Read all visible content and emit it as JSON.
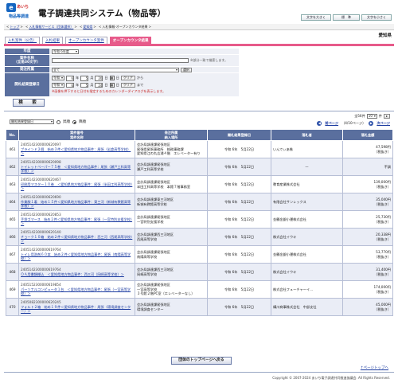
{
  "logo": {
    "mark": "e",
    "top_text": "あいち",
    "bottom_text": "物品等調達",
    "mark_icon": "aichi-logo-icon"
  },
  "site_title": "電子調達共同システム（物品等）",
  "header_buttons": [
    "文字を大きく",
    "標　準",
    "文字を小さく"
  ],
  "breadcrumb": [
    "トップ",
    "入札情報サービス（団体選択）",
    "愛知県",
    "入札情報-オープンカウンタ結果"
  ],
  "prefecture": "愛知県",
  "tabs": [
    "入札案件（公告）",
    "入札結果",
    "オープンカウンタ案件",
    "オープンカウンタ結果"
  ],
  "active_tab": 3,
  "search": {
    "fiscal_year_label": "年度",
    "fiscal_year_value": "令和 6年度",
    "case_name_label": "案件名称\n（全角30文字）",
    "case_name_value": "",
    "case_name_note": "※部分一致で検索します。",
    "office_label": "発注所属",
    "office_value": "全て",
    "office_button": "選択",
    "date_label": "開札結果登録日",
    "from": {
      "era": "令和",
      "year": "6",
      "year_unit": "年",
      "month": "5",
      "month_unit": "月",
      "day": "20",
      "day_unit": "日",
      "suffix": "日",
      "clear": "クリア",
      "tail": "から"
    },
    "to": {
      "era": "令和",
      "year": "6",
      "year_unit": "年",
      "month": "5",
      "month_unit": "月",
      "day": "24",
      "day_unit": "日",
      "suffix": "日",
      "clear": "クリア",
      "tail": "まで"
    },
    "calendar_icon": "calendar-icon",
    "date_note": "※画像を押下すると日付を指定するためのカレンダーダイアログを表示します。",
    "search_button": "検　索"
  },
  "list_controls": {
    "sort_select": "開札結果登録日",
    "sort_asc": "昇順",
    "sort_desc": "降順",
    "sort_selected": "desc",
    "total": "全56件",
    "per_page": "10",
    "per_page_unit": "件",
    "prev": "前ページ",
    "page_status": "（4/10ページ）",
    "next": "次ページ"
  },
  "table": {
    "headers": {
      "no": "No.",
      "case": "案件番号\n案件名称",
      "office": "発注所属\n納入場所",
      "date": "開札結果登録日",
      "winner": "落札者",
      "amount": "落札金額"
    },
    "rows": [
      {
        "no": "461",
        "case_no": "2405142300000620097",
        "case_name": "ブラインド２個　始め３件＜愛知県地方物品事件：尾張（岩倉高等学校）＞",
        "office": "会計局調達課尾張地区",
        "place": "尾張県尾張事務所　総務事務課\n愛知県江の丸吉浦４階　エレベーター有り",
        "date": "令和 6年　5月22日",
        "winner": "いんでぃあ株",
        "amount": "47,598円",
        "tax": "（税抜き）"
      },
      {
        "no": "462",
        "case_no": "2405142300000620098",
        "case_name": "トイレットペーパー７５巻　＜愛知県地方物品事件：尾張（瀬戸工科高等学校）＞",
        "office": "会計局調達課尾張地区",
        "place": "瀬戸工科高等学校",
        "date": "令和 6年　5月22日",
        "winner": "—",
        "amount": "不調",
        "tax": ""
      },
      {
        "no": "463",
        "case_no": "2405142300000620467",
        "case_name": "印刷用マスター１０巻　＜愛知県地方物品事件：尾張（半田工科高等学校）＞",
        "office": "会計局調達課尾張地区",
        "place": "半田工科高等学校　本館７階事務室",
        "date": "令和 6年　5月22日",
        "winner": "教育産業株式会社",
        "amount": "139,000円",
        "tax": "（税抜き）"
      },
      {
        "no": "464",
        "case_no": "2405142300000620690",
        "case_name": "作業服１着　始め１５件＜愛知県地方物品事件：東三河（新城有教館高等学校）＞",
        "office": "会計局調達課東三河地区",
        "place": "新城有教館高等学校",
        "date": "令和 6年　5月22日",
        "winner": "有限会社サンレックス",
        "amount": "35,040円",
        "tax": "（税抜き）"
      },
      {
        "no": "465",
        "case_no": "2405142300000620853",
        "case_name": "手袋ゴマース　始め２件＜愛知県地方物品事件：尾張（一宮特別支援学校）＞",
        "office": "会計局調達課尾張地区",
        "place": "一宮特別支援学校",
        "date": "令和 6年　5月22日",
        "winner": "金鶴金銀小運株式会社",
        "amount": "25,730円",
        "tax": "（税抜き）"
      },
      {
        "no": "466",
        "case_no": "2405142300000620140",
        "case_name": "チョーク１０箱　始め２件＜愛知県地方物品事件：西三河（西尾高等学校）＞",
        "office": "会計局調達課西三河地区",
        "place": "西尾高等学校",
        "date": "令和 6年　5月22日",
        "winner": "株式会社イウキ",
        "amount": "20,338円",
        "tax": "（税抜き）"
      },
      {
        "no": "467",
        "case_no": "2405142300000619764",
        "case_name": "トイレ用洗剤６０本　始め２件＜愛知県地方物品事件：尾張（南陽高等学校）＞",
        "office": "会計局調達課尾張地区",
        "place": "南陽高等学校",
        "date": "令和 6年　5月22日",
        "winner": "金鶴金銀小運株式会社",
        "amount": "53,770円",
        "tax": "（税抜き）"
      },
      {
        "no": "468",
        "case_no": "2405142300000619764",
        "case_name": "ＯＡ用書類棚込　＜愛知県地方物品事件：西三河（岡崎高等学校）＞",
        "office": "会計局調達課西三河地区",
        "place": "岡崎高等学校",
        "date": "令和 6年　5月22日",
        "winner": "株式会社イウキ",
        "amount": "31,400円",
        "tax": "（税抜き）"
      },
      {
        "no": "469",
        "case_no": "2405152300000619854",
        "case_name": "パーソナルコンピュータ１台　＜愛知県地方物品事件：尾張（一宮高等学校）＞",
        "office": "会計局調達課尾張地区",
        "place": "一宮高等学校\n３号館２階PC室（エレベーターなし）",
        "date": "令和 6年　5月22日",
        "winner": "株式会社フューチャーイ…",
        "amount": "174,000円",
        "tax": "（税抜き）"
      },
      {
        "no": "470",
        "case_no": "2405082300000620245",
        "case_name": "フォルト２箱　始め１９件＜愛知県地方物品事件：尾張（環境調査センター）＞",
        "office": "会計局調達課尾張地区",
        "place": "環境調査センター",
        "date": "令和 6年　5月22日",
        "winner": "構川商事株式会社　中部支社",
        "amount": "45,000円",
        "tax": "（税抜き）"
      }
    ]
  },
  "back_button": "団体のトップページへ戻る",
  "page_top": "↑ページトップへ",
  "copyright": "Copyright © 2007-2024 あいち電子調達共同推進協議会. All Rights Reserved."
}
